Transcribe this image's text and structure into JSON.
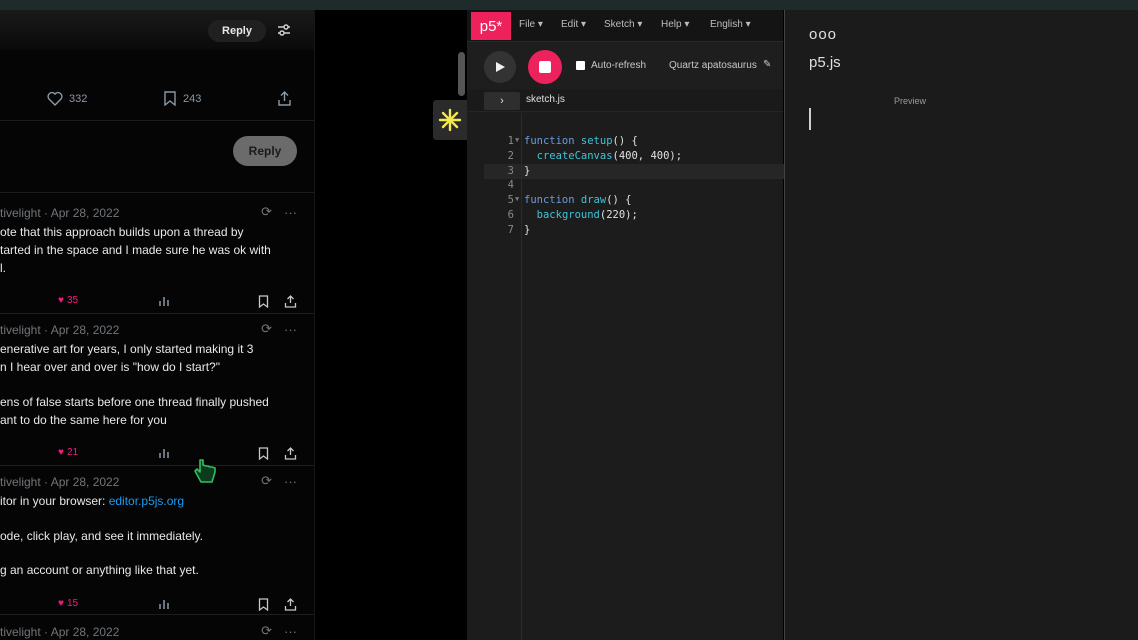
{
  "twitter": {
    "top_reply_label": "Reply",
    "stats": {
      "likes": "332",
      "bookmarks": "243"
    },
    "reply_button_label": "Reply",
    "tweets": [
      {
        "head": "tivelight · Apr 28, 2022",
        "lines": [
          "ote that this approach builds upon a thread by",
          "tarted in the space and I made sure he was ok with",
          "l."
        ],
        "likes": "35"
      },
      {
        "head": "tivelight · Apr 28, 2022",
        "lines": [
          "enerative art for years, I only started making it 3",
          "n I hear over and over is \"how do I start?\"",
          "ens of false starts before one thread finally pushed",
          "ant to do the same here for you"
        ],
        "likes": "21"
      },
      {
        "head": "tivelight · Apr 28, 2022",
        "line1_prefix": "itor in your browser: ",
        "line1_link": "editor.p5js.org",
        "lines": [
          "ode, click play, and see it immediately.",
          "g an account or anything like that yet."
        ],
        "likes": "15"
      },
      {
        "head": "tivelight · Apr 28, 2022"
      }
    ]
  },
  "editor": {
    "logo": "p5*",
    "menus": [
      "File ▾",
      "Edit ▾",
      "Sketch ▾",
      "Help ▾",
      "English ▾"
    ],
    "auto_refresh_label": "Auto-refresh",
    "sketch_name": "Quartz apatosaurus",
    "file_tab": "sketch.js",
    "code": [
      {
        "n": "1",
        "fold": true,
        "parts": [
          [
            "kw",
            "function "
          ],
          [
            "fn",
            "setup"
          ],
          [
            "punc",
            "() {"
          ]
        ]
      },
      {
        "n": "2",
        "fold": false,
        "parts": [
          [
            "punc",
            "  "
          ],
          [
            "fn",
            "createCanvas"
          ],
          [
            "punc",
            "(400, 400);"
          ]
        ]
      },
      {
        "n": "3",
        "fold": false,
        "parts": [
          [
            "punc",
            "}"
          ]
        ]
      },
      {
        "n": "4",
        "fold": false,
        "parts": [
          [
            "punc",
            ""
          ]
        ]
      },
      {
        "n": "5",
        "fold": true,
        "parts": [
          [
            "kw",
            "function "
          ],
          [
            "fn",
            "draw"
          ],
          [
            "punc",
            "() {"
          ]
        ]
      },
      {
        "n": "6",
        "fold": false,
        "parts": [
          [
            "punc",
            "  "
          ],
          [
            "fn",
            "background"
          ],
          [
            "punc",
            "(220);"
          ]
        ]
      },
      {
        "n": "7",
        "fold": false,
        "parts": [
          [
            "punc",
            "}"
          ]
        ]
      }
    ]
  },
  "preview": {
    "dots": "ooo",
    "title": "p5.js",
    "label": "Preview"
  },
  "colors": {
    "p5_pink": "#ed225d",
    "like_pink": "#f91880",
    "link_blue": "#1d9bf0",
    "code_keyword": "#6a9be0",
    "code_function": "#3ec4d8"
  }
}
